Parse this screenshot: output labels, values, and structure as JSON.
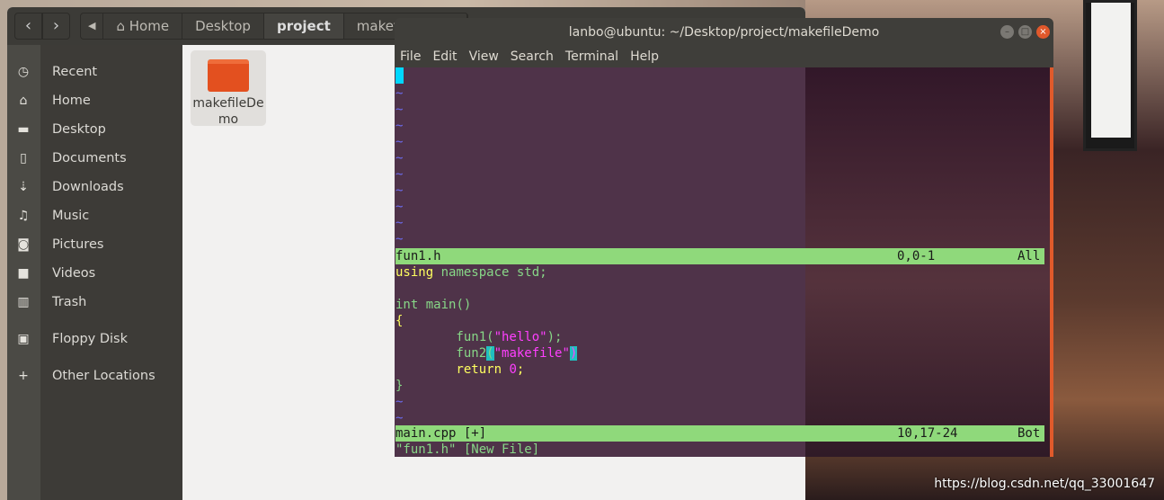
{
  "file_manager": {
    "breadcrumbs": [
      "Home",
      "Desktop",
      "project",
      "makefileDemo"
    ],
    "active_crumb": "project",
    "sidebar": [
      {
        "icon": "clock-icon",
        "label": "Recent"
      },
      {
        "icon": "home-icon",
        "label": "Home"
      },
      {
        "icon": "folder-icon",
        "label": "Desktop"
      },
      {
        "icon": "document-icon",
        "label": "Documents"
      },
      {
        "icon": "download-icon",
        "label": "Downloads"
      },
      {
        "icon": "music-icon",
        "label": "Music"
      },
      {
        "icon": "camera-icon",
        "label": "Pictures"
      },
      {
        "icon": "video-icon",
        "label": "Videos"
      },
      {
        "icon": "trash-icon",
        "label": "Trash"
      },
      {
        "icon": "floppy-icon",
        "label": "Floppy Disk"
      },
      {
        "icon": "plus-icon",
        "label": "Other Locations"
      }
    ],
    "files": [
      {
        "name_line1": "makefileDe",
        "name_line2": "mo"
      }
    ]
  },
  "terminal": {
    "title": "lanbo@ubuntu: ~/Desktop/project/makefileDemo",
    "menu": [
      "File",
      "Edit",
      "View",
      "Search",
      "Terminal",
      "Help"
    ],
    "top_status": {
      "file": "fun1.h",
      "pos": "0,0-1",
      "scroll": "All"
    },
    "code": {
      "l1a": "using",
      "l1b": " namespace std;",
      "l3a": "int",
      "l3b": " main()",
      "l4": "{",
      "l5a": "        fun1(",
      "l5b": "\"hello\"",
      "l5c": ");",
      "l6a": "        fun2",
      "l6b": "(",
      "l6c": "\"makefile\"",
      "l6d": ")",
      "l7a": "        return ",
      "l7b": "0",
      "l7c": ";",
      "l8": "}"
    },
    "tilde": "~",
    "bottom_status": {
      "file": "main.cpp [+]",
      "pos": "10,17-24",
      "scroll": "Bot"
    },
    "message": "\"fun1.h\" [New File]",
    "colors": {
      "background": "#4f3349",
      "status": "#8fd97b",
      "keyword": "#ffff5f",
      "string": "#ff3fff",
      "tilde": "#6c6cf0"
    }
  },
  "watermark": "https://blog.csdn.net/qq_33001647"
}
